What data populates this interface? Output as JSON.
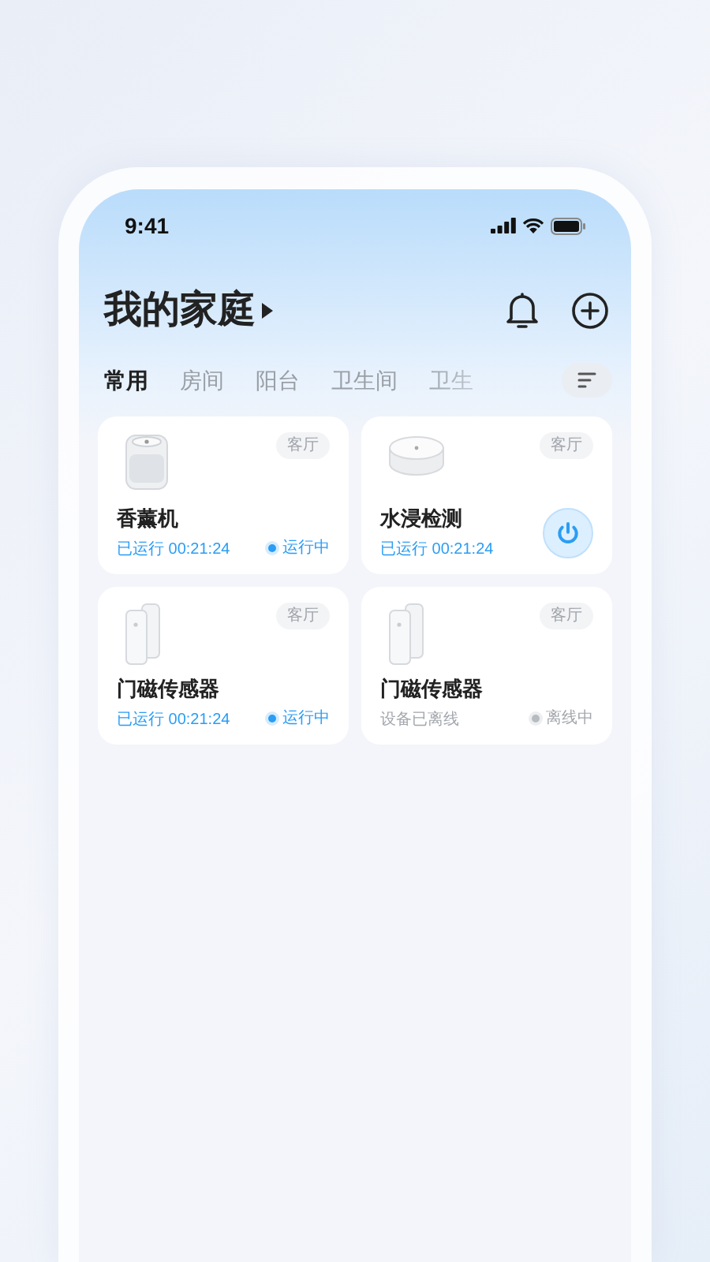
{
  "status_bar": {
    "time": "9:41"
  },
  "header": {
    "title": "我的家庭"
  },
  "tabs": [
    {
      "label": "常用",
      "selected": true
    },
    {
      "label": "房间",
      "selected": false
    },
    {
      "label": "阳台",
      "selected": false
    },
    {
      "label": "卫生间",
      "selected": false
    },
    {
      "label": "卫生",
      "selected": false
    }
  ],
  "devices": [
    {
      "kind": "diffuser",
      "name": "香薰机",
      "room": "客厅",
      "runtime": "已运行 00:21:24",
      "online": true,
      "status": "运行中"
    },
    {
      "kind": "water-sensor",
      "name": "水浸检测",
      "room": "客厅",
      "runtime": "已运行 00:21:24",
      "online": true,
      "power_on": true
    },
    {
      "kind": "door-sensor",
      "name": "门磁传感器",
      "room": "客厅",
      "runtime": "已运行 00:21:24",
      "online": true,
      "status": "运行中"
    },
    {
      "kind": "door-sensor",
      "name": "门磁传感器",
      "room": "客厅",
      "runtime": "设备已离线",
      "online": false,
      "status": "离线中"
    }
  ]
}
